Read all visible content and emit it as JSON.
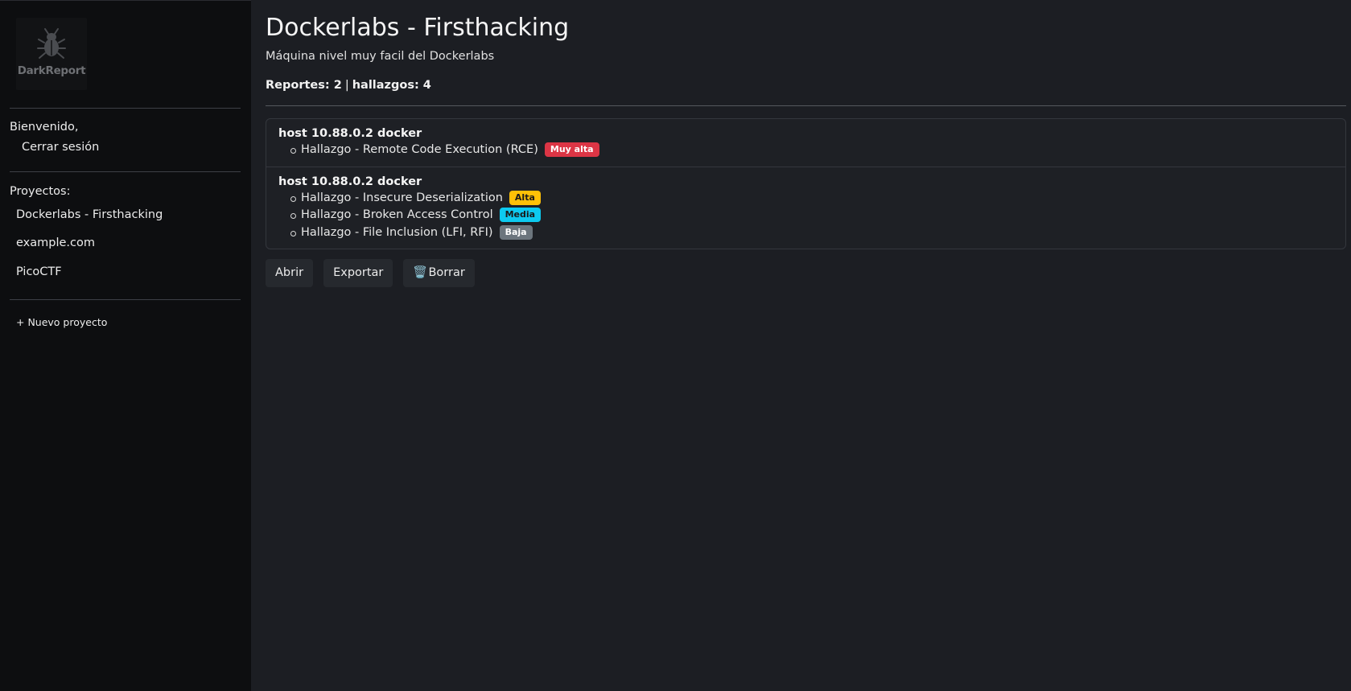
{
  "app": {
    "logo_text": "DarkReport"
  },
  "sidebar": {
    "welcome": "Bienvenido,",
    "logout": "Cerrar sesión",
    "projects_label": "Proyectos:",
    "projects": [
      {
        "label": "Dockerlabs - Firsthacking"
      },
      {
        "label": "example.com"
      },
      {
        "label": "PicoCTF"
      }
    ],
    "new_project": "+ Nuevo proyecto"
  },
  "main": {
    "title": "Dockerlabs - Firsthacking",
    "subtitle": "Máquina nivel muy facil del Dockerlabs",
    "stats": {
      "reports_text": "Reportes: 2",
      "separator": "|",
      "findings_text": "hallazgos: 4"
    },
    "reports": [
      {
        "host": "host 10.88.0.2 docker",
        "findings": [
          {
            "title": "Hallazgo - Remote Code Execution (RCE)",
            "severity": "Muy alta",
            "color": "#dc3545"
          }
        ]
      },
      {
        "host": "host 10.88.0.2 docker",
        "findings": [
          {
            "title": "Hallazgo - Insecure Deserialization",
            "severity": "Alta",
            "color": "#ffc107"
          },
          {
            "title": "Hallazgo - Broken Access Control",
            "severity": "Media",
            "color": "#0dcaf0"
          },
          {
            "title": "Hallazgo - File Inclusion (LFI, RFI)",
            "severity": "Baja",
            "color": "#6c757d"
          }
        ]
      }
    ],
    "actions": {
      "open": "Abrir",
      "export": "Exportar",
      "delete_icon": "🗑️",
      "delete": "Borrar"
    }
  }
}
